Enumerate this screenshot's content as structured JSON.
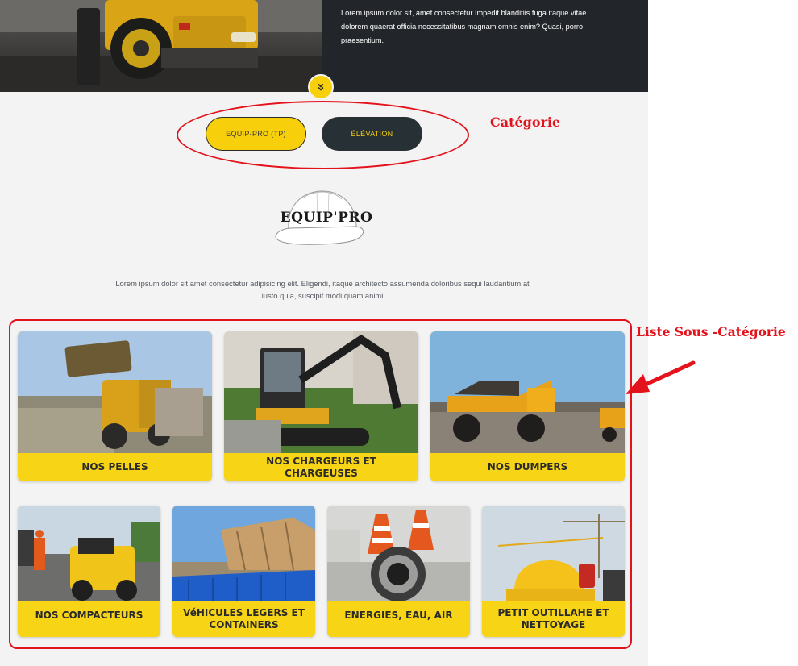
{
  "hero": {
    "description": "Lorem ipsum dolor sit, amet consectetur Impedit blanditiis fuga itaque vitae dolorem quaerat officia necessitatibus magnam omnis enim? Quasi, porro praesentium.",
    "scroll_icon": "double-chevron-down-icon"
  },
  "categories": [
    {
      "label": "EQUIP-PRO (TP)",
      "active": true
    },
    {
      "label": "ÉLÉVATION",
      "active": false
    }
  ],
  "brand": {
    "name": "EQUIP'PRO"
  },
  "intro": "Lorem ipsum dolor sit amet consectetur adipisicing elit. Eligendi, itaque architecto assumenda doloribus sequi laudantium at iusto quia, suscipit modi quam animi",
  "subcategories": [
    {
      "label": "NOS PELLES"
    },
    {
      "label": "NOS CHARGEURS ET CHARGEUSES"
    },
    {
      "label": "NOS DUMPERS"
    },
    {
      "label": "NOS COMPACTEURS"
    },
    {
      "label": "VéHICULES LEGERS ET CONTAINERS"
    },
    {
      "label": "ENERGIES, EAU, AIR"
    },
    {
      "label": "PETIT OUTILLAHE ET NETTOYAGE"
    }
  ],
  "annotations": {
    "category_label": "Catégorie",
    "subcategory_label": "Liste Sous -Catégorie"
  },
  "colors": {
    "accent_yellow": "#f7cf0b",
    "dark": "#263035",
    "annotation_red": "#e3121b"
  }
}
